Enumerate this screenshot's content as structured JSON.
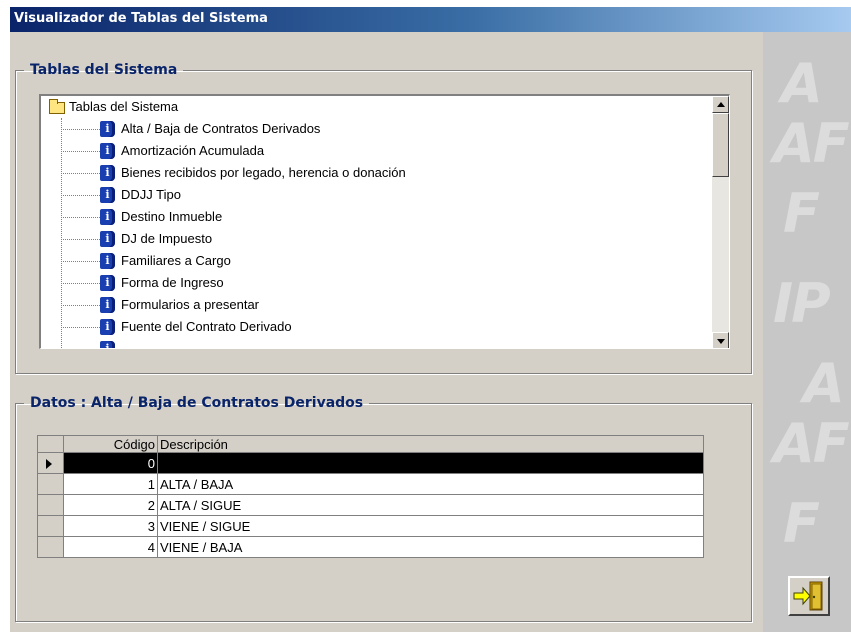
{
  "window": {
    "title": "Visualizador de Tablas del Sistema"
  },
  "tables_group": {
    "legend": "Tablas del Sistema",
    "root_label": "Tablas del Sistema",
    "items": [
      "Alta / Baja de Contratos Derivados",
      "Amortización Acumulada",
      "Bienes recibidos por legado, herencia o donación",
      "DDJJ Tipo",
      "Destino Inmueble",
      "DJ de Impuesto",
      "Familiares a Cargo",
      "Forma de Ingreso",
      "Formularios a presentar",
      "Fuente del Contrato Derivado"
    ],
    "scroll_position": 0.0
  },
  "data_group": {
    "legend": "Datos : Alta / Baja de Contratos Derivados",
    "columns": [
      "Código",
      "Descripción"
    ],
    "rows": [
      {
        "code": "0",
        "desc": ""
      },
      {
        "code": "1",
        "desc": "ALTA / BAJA"
      },
      {
        "code": "2",
        "desc": "ALTA / SIGUE"
      },
      {
        "code": "3",
        "desc": "VIENE / SIGUE"
      },
      {
        "code": "4",
        "desc": "VIENE / BAJA"
      }
    ],
    "selected_row": 0
  },
  "icons": {
    "folder": "folder-icon",
    "table": "info-book-icon",
    "exit": "exit-door-icon"
  },
  "colors": {
    "title_bar": "#0a246a",
    "legend_text": "#0a246a",
    "window_bg": "#d4d0c8",
    "selected_row_bg": "#000000"
  }
}
